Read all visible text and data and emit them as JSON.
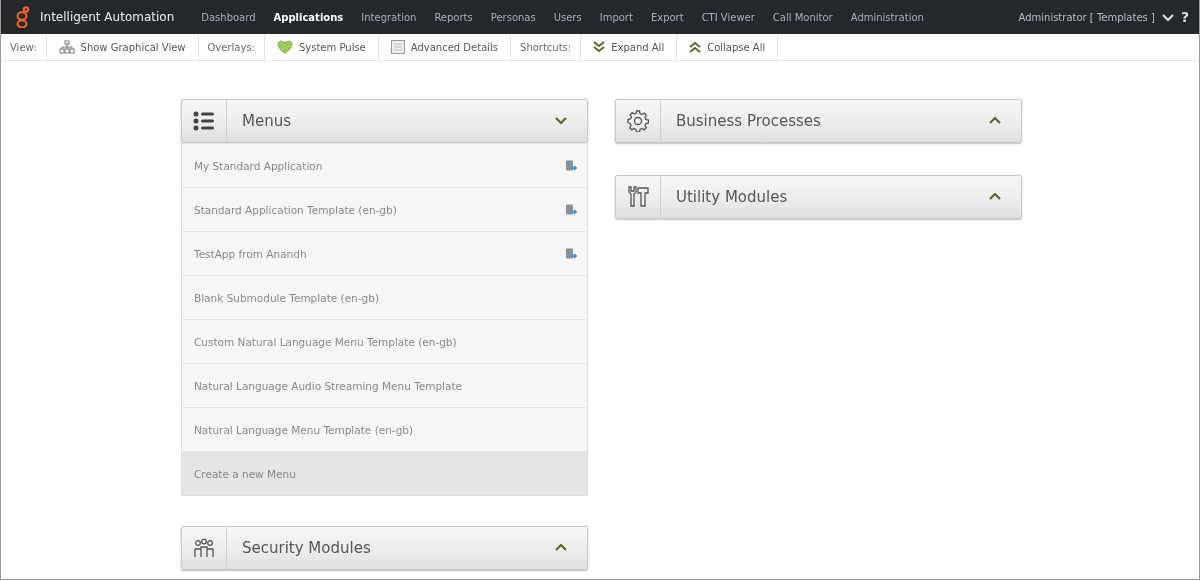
{
  "header": {
    "product": "Intelligent Automation",
    "nav": [
      {
        "label": "Dashboard",
        "selected": false
      },
      {
        "label": "Applications",
        "selected": true
      },
      {
        "label": "Integration",
        "selected": false
      },
      {
        "label": "Reports",
        "selected": false
      },
      {
        "label": "Personas",
        "selected": false
      },
      {
        "label": "Users",
        "selected": false
      },
      {
        "label": "Import",
        "selected": false
      },
      {
        "label": "Export",
        "selected": false
      },
      {
        "label": "CTI Viewer",
        "selected": false
      },
      {
        "label": "Call Monitor",
        "selected": false
      },
      {
        "label": "Administration",
        "selected": false
      }
    ],
    "user": "Administrator [ Templates ]",
    "help": "?"
  },
  "toolbar": [
    {
      "kind": "label",
      "label": "View:"
    },
    {
      "kind": "graph",
      "label": "Show Graphical View"
    },
    {
      "kind": "label",
      "label": "Overlays:"
    },
    {
      "kind": "pulse",
      "label": "System Pulse"
    },
    {
      "kind": "details",
      "label": "Advanced Details"
    },
    {
      "kind": "label",
      "label": "Shortcuts:"
    },
    {
      "kind": "expand",
      "label": "Expand All"
    },
    {
      "kind": "collapse",
      "label": "Collapse All"
    }
  ],
  "columns": [
    {
      "panels": [
        {
          "kind": "menus",
          "title": "Menus",
          "expanded": true,
          "items": [
            {
              "kind": "app",
              "label": "My Standard Application"
            },
            {
              "kind": "app",
              "label": "Standard Application Template (en-gb)"
            },
            {
              "kind": "app",
              "label": "TestApp from Anandh"
            },
            {
              "kind": "template",
              "label": "Blank Submodule Template (en-gb)"
            },
            {
              "kind": "template",
              "label": "Custom Natural Language Menu Template (en-gb)"
            },
            {
              "kind": "template",
              "label": "Natural Language Audio Streaming Menu Template"
            },
            {
              "kind": "template",
              "label": "Natural Language Menu Template (en-gb)"
            },
            {
              "kind": "create",
              "label": "Create a new Menu"
            }
          ]
        },
        {
          "kind": "security",
          "title": "Security Modules",
          "expanded": false
        }
      ]
    },
    {
      "panels": [
        {
          "kind": "processes",
          "title": "Business Processes",
          "expanded": false
        },
        {
          "kind": "utility",
          "title": "Utility Modules",
          "expanded": false
        }
      ]
    }
  ]
}
